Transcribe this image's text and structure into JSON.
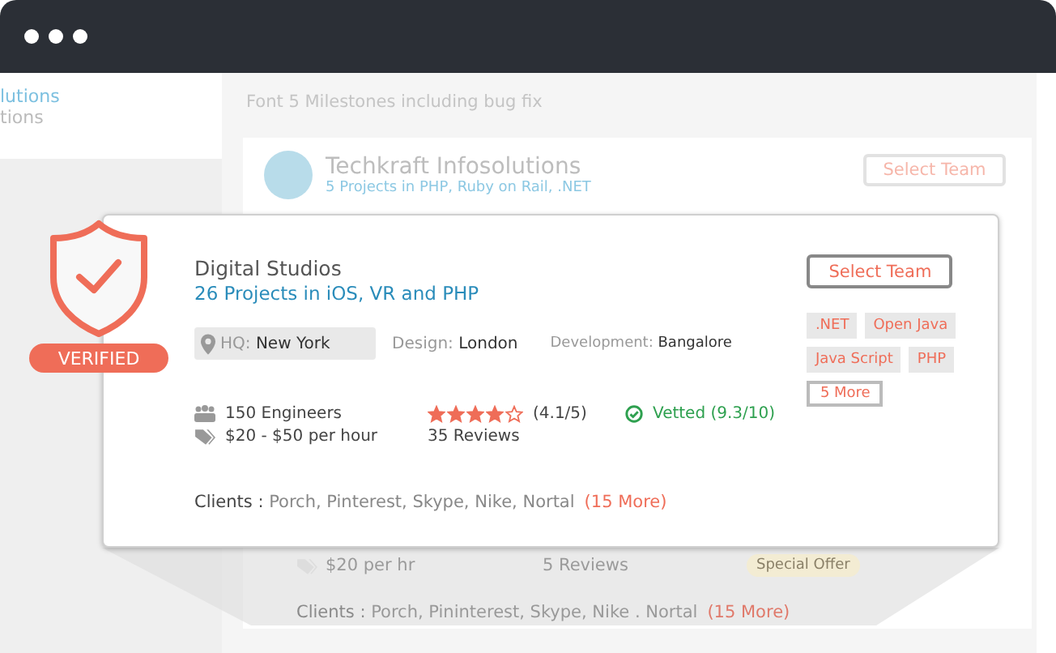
{
  "sidebar": {
    "name": "lutions",
    "detail": "tions"
  },
  "page_heading": "Font 5 Milestones including bug fix",
  "background_card": {
    "name": "Techkraft Infosolutions",
    "projects": "5 Projects in PHP, Ruby on Rail, .NET",
    "button": "Select Team",
    "rate": "$20 per hr",
    "reviews": "5 Reviews",
    "badge": "Special Offer",
    "clients_label": "Clients :",
    "clients": "Porch, Pininterest, Skype, Nike  .  Nortal",
    "clients_more": "(15 More)"
  },
  "featured_card": {
    "badge": "VERIFIED",
    "name": "Digital Studios",
    "projects": "26 Projects in iOS, VR and PHP",
    "button": "Select Team",
    "locations": [
      {
        "kind": "hq",
        "label": "HQ:",
        "value": "New York"
      },
      {
        "kind": "plain",
        "label": "Design:",
        "value": "London"
      },
      {
        "kind": "plain",
        "label": "Development:",
        "value": "Bangalore"
      }
    ],
    "engineers": "150 Engineers",
    "rate": "$20 - $50 per hour",
    "stars": 4,
    "rating": "(4.1/5)",
    "reviews": "35 Reviews",
    "vetted": "Vetted (9.3/10)",
    "tags": [
      {
        "kind": "filled",
        "label": ".NET"
      },
      {
        "kind": "filled",
        "label": "Open Java"
      },
      {
        "kind": "filled",
        "label": "Java Script"
      },
      {
        "kind": "filled",
        "label": "PHP"
      },
      {
        "kind": "outline",
        "label": "5 More"
      }
    ],
    "clients_label": "Clients :",
    "clients": "Porch, Pinterest, Skype, Nike, Nortal",
    "clients_more": "(15 More)"
  }
}
